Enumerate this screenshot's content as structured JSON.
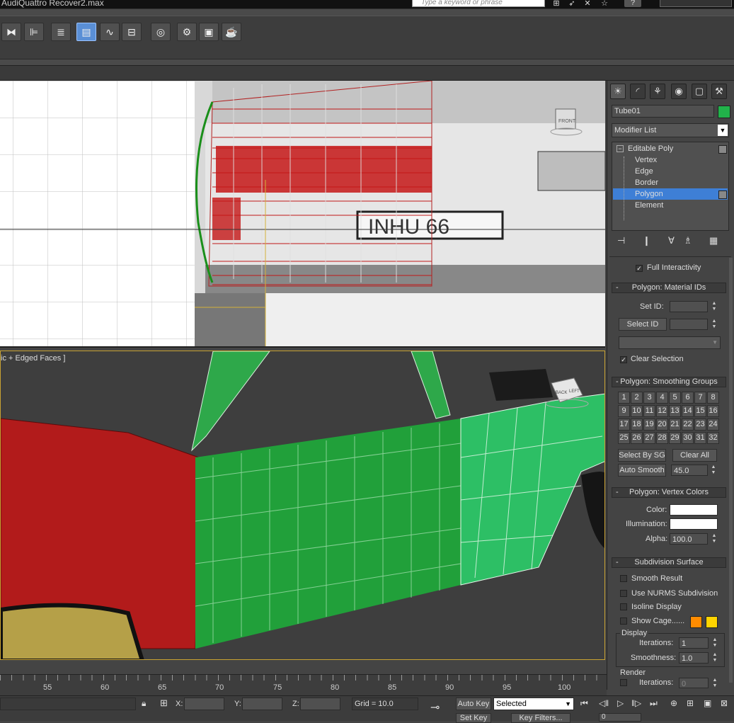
{
  "window": {
    "title": "AudiQuattro Recover2.max",
    "search_placeholder": "Type a keyword or phrase"
  },
  "toolbar": {
    "icons": [
      "mirror-icon",
      "align-icon",
      "layer-manager-icon",
      "scene-explorer-icon",
      "curve-editor-icon",
      "schematic-view-icon",
      "material-editor-icon",
      "render-setup-icon",
      "rendered-frame-icon",
      "render-production-icon"
    ]
  },
  "viewport_front": {
    "cube_label": "FRONT"
  },
  "viewport_persp": {
    "label": "ic + Edged Faces ]",
    "cube_labels": [
      "BACK",
      "LEFT"
    ]
  },
  "command_panel": {
    "object_name": "Tube01",
    "object_color": "#21b24a",
    "modifier_list": "Modifier List",
    "stack": [
      "Editable Poly",
      "Vertex",
      "Edge",
      "Border",
      "Polygon",
      "Element"
    ],
    "selected_stack_item": "Polygon",
    "full_interactivity": "Full Interactivity",
    "material_ids": {
      "title": "Polygon: Material IDs",
      "set_id": "Set ID:",
      "select_id": "Select ID",
      "clear_selection": "Clear Selection"
    },
    "smoothing": {
      "title": "Polygon: Smoothing Groups",
      "groups": [
        "1",
        "2",
        "3",
        "4",
        "5",
        "6",
        "7",
        "8",
        "9",
        "10",
        "11",
        "12",
        "13",
        "14",
        "15",
        "16",
        "17",
        "18",
        "19",
        "20",
        "21",
        "22",
        "23",
        "24",
        "25",
        "26",
        "27",
        "28",
        "29",
        "30",
        "31",
        "32"
      ],
      "select_by_sg": "Select By SG",
      "clear_all": "Clear All",
      "auto_smooth": "Auto Smooth",
      "auto_smooth_value": "45.0"
    },
    "vertex_colors": {
      "title": "Polygon: Vertex Colors",
      "color": "Color:",
      "illumination": "Illumination:",
      "alpha": "Alpha:",
      "alpha_value": "100.0"
    },
    "subdivision": {
      "title": "Subdivision Surface",
      "smooth_result": "Smooth Result",
      "use_nurms": "Use NURMS Subdivision",
      "isoline": "Isoline Display",
      "show_cage": "Show Cage......",
      "cage_colors": [
        "#ff8c00",
        "#ffd400"
      ],
      "display": "Display",
      "iterations": "Iterations:",
      "iterations_value": "1",
      "smoothness": "Smoothness:",
      "smoothness_value": "1.0",
      "render": "Render",
      "render_iterations_value": "0"
    }
  },
  "timeline": {
    "numbers": [
      "55",
      "60",
      "65",
      "70",
      "75",
      "80",
      "85",
      "90",
      "95",
      "100"
    ]
  },
  "status": {
    "x": "X:",
    "y": "Y:",
    "z": "Z:",
    "grid": "Grid = 10.0",
    "auto_key": "Auto Key",
    "selected": "Selected",
    "set_key": "Set Key",
    "key_filters": "Key Filters...",
    "frame": "0"
  }
}
